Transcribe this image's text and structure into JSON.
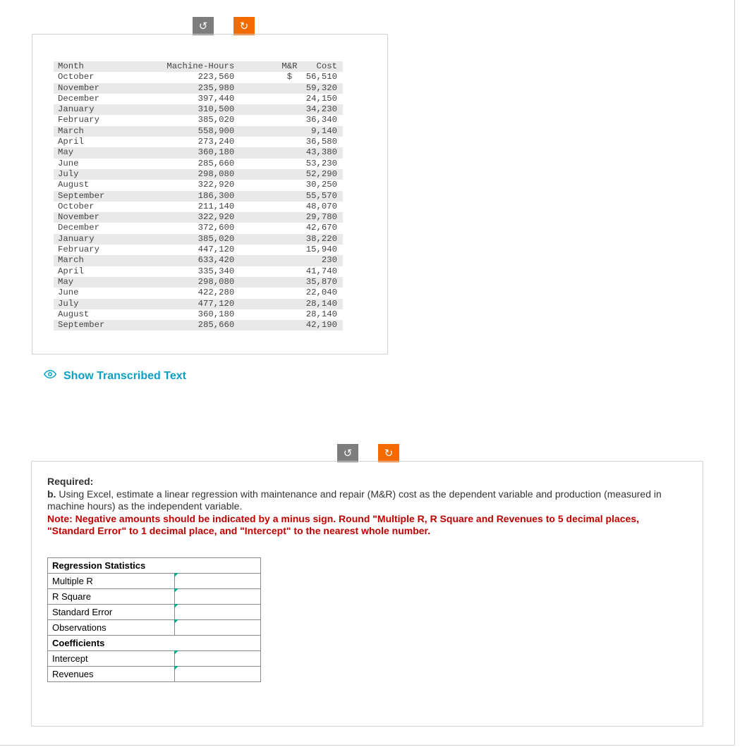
{
  "rotate_ccw": "↺",
  "rotate_cw": "↻",
  "data_table": {
    "headers": {
      "month": "Month",
      "hours": "Machine-Hours",
      "mr": "M&R",
      "cost": "Cost"
    },
    "currency": "$",
    "rows": [
      {
        "month": "October",
        "hours": "223,560",
        "cost": "56,510",
        "sym": "$ "
      },
      {
        "month": "November",
        "hours": "235,980",
        "cost": "59,320"
      },
      {
        "month": "December",
        "hours": "397,440",
        "cost": "24,150"
      },
      {
        "month": "January",
        "hours": "310,500",
        "cost": "34,230"
      },
      {
        "month": "February",
        "hours": "385,020",
        "cost": "36,340"
      },
      {
        "month": "March",
        "hours": "558,900",
        "cost": "9,140"
      },
      {
        "month": "April",
        "hours": "273,240",
        "cost": "36,580"
      },
      {
        "month": "May",
        "hours": "360,180",
        "cost": "43,380"
      },
      {
        "month": "June",
        "hours": "285,660",
        "cost": "53,230"
      },
      {
        "month": "July",
        "hours": "298,080",
        "cost": "52,290"
      },
      {
        "month": "August",
        "hours": "322,920",
        "cost": "30,250"
      },
      {
        "month": "September",
        "hours": "186,300",
        "cost": "55,570"
      },
      {
        "month": "October",
        "hours": "211,140",
        "cost": "48,070"
      },
      {
        "month": "November",
        "hours": "322,920",
        "cost": "29,780"
      },
      {
        "month": "December",
        "hours": "372,600",
        "cost": "42,670"
      },
      {
        "month": "January",
        "hours": "385,020",
        "cost": "38,220"
      },
      {
        "month": "February",
        "hours": "447,120",
        "cost": "15,940"
      },
      {
        "month": "March",
        "hours": "633,420",
        "cost": "230"
      },
      {
        "month": "April",
        "hours": "335,340",
        "cost": "41,740"
      },
      {
        "month": "May",
        "hours": "298,080",
        "cost": "35,870"
      },
      {
        "month": "June",
        "hours": "422,280",
        "cost": "22,040"
      },
      {
        "month": "July",
        "hours": "477,120",
        "cost": "28,140"
      },
      {
        "month": "August",
        "hours": "360,180",
        "cost": "28,140"
      },
      {
        "month": "September",
        "hours": "285,660",
        "cost": "42,190"
      }
    ]
  },
  "show_transcribed": "Show Transcribed Text",
  "question": {
    "required": "Required:",
    "body1_prefix": "b. ",
    "body1": "Using Excel, estimate a linear regression with maintenance and repair (M&R) cost as the dependent variable and production (measured in machine hours) as the independent variable.",
    "note": "Note: Negative amounts should be indicated by a minus sign. Round \"Multiple R, R Square and Revenues to 5 decimal places, \"Standard Error\" to 1 decimal place, and \"Intercept\" to the nearest whole number."
  },
  "reg": {
    "header1": "Regression Statistics",
    "rows1": [
      "Multiple R",
      "R Square",
      "Standard Error",
      "Observations"
    ],
    "header2": "Coefficients",
    "rows2": [
      "Intercept",
      "Revenues"
    ]
  }
}
